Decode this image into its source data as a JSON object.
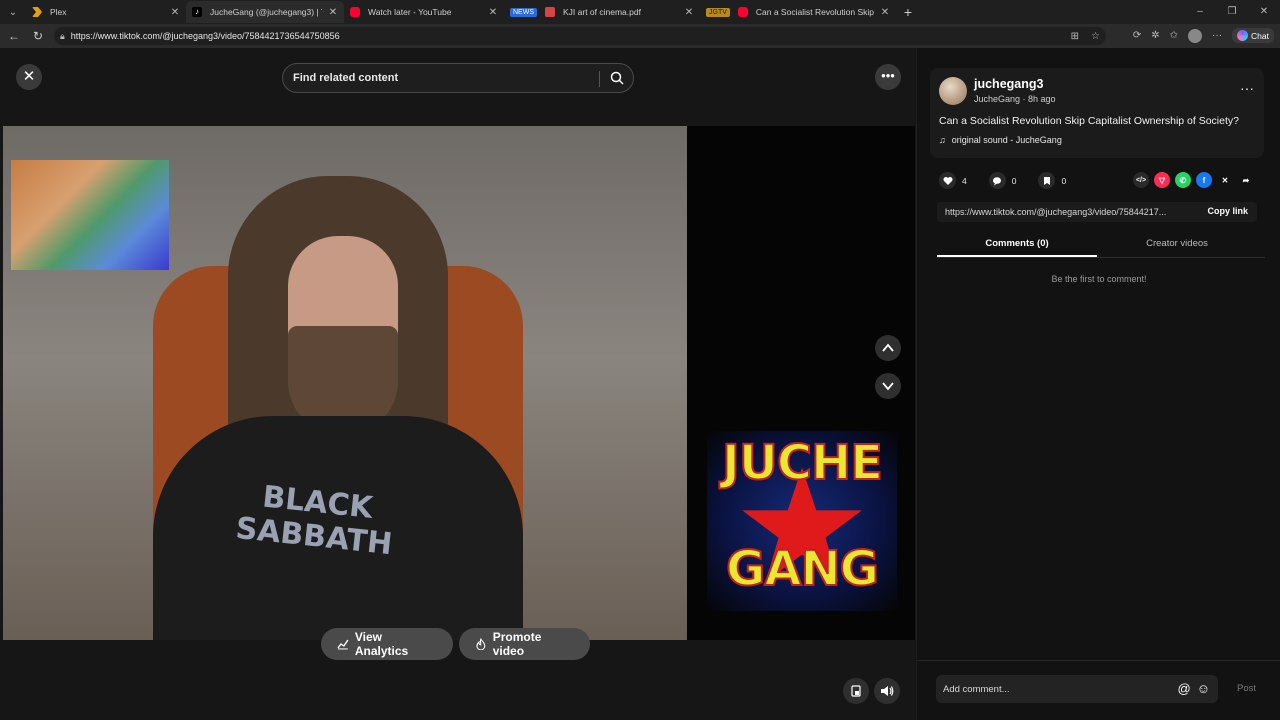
{
  "browser": {
    "tabs": [
      {
        "label": "Plex",
        "icon_color": "#e5a00d",
        "active": false
      },
      {
        "label": "JucheGang (@juchegang3) | T",
        "icon_color": "#ffffff",
        "active": true
      },
      {
        "label": "Watch later - YouTube",
        "icon_color": "#ff0033",
        "active": false
      },
      {
        "label": "KJI art of cinema.pdf",
        "badge": "NEWS",
        "badge_color": "#2b6ad8",
        "icon_color": "#d64545",
        "active": false
      },
      {
        "label": "Can a Socialist Revolution Skip Ca",
        "badge": "JGTV",
        "badge_color": "#b88a1c",
        "icon_color": "#ff0033",
        "active": false
      }
    ],
    "url": "https://www.tiktok.com/@juchegang3/video/7584421736544750856",
    "chat_label": "Chat"
  },
  "player": {
    "search_placeholder": "Find related content",
    "logo_line1": "JUCHE",
    "logo_line2": "GANG",
    "shirt_print": "BLACK SABBATH",
    "view_analytics": "View Analytics",
    "promote_video": "Promote video"
  },
  "panel": {
    "username": "juchegang3",
    "meta": "JucheGang · 8h ago",
    "title": "Can a Socialist Revolution Skip Capitalist Ownership of Society?",
    "sound": "original sound - JucheGang",
    "likes": "4",
    "comments": "0",
    "saves": "0",
    "share_link": "https://www.tiktok.com/@juchegang3/video/75844217...",
    "copy_link": "Copy link",
    "tab_comments": "Comments (0)",
    "tab_creator": "Creator videos",
    "empty_comments": "Be the first to comment!",
    "comment_placeholder": "Add comment...",
    "post": "Post"
  }
}
